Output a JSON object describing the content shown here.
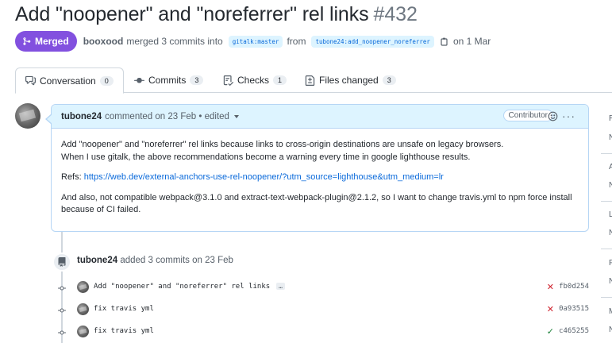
{
  "title": {
    "text": "Add \"noopener\" and \"noreferrer\" rel links",
    "number": "#432"
  },
  "meta": {
    "state": "Merged",
    "author": "booxood",
    "action_text": "merged 3 commits into",
    "base_branch": "gitalk:master",
    "from_text": "from",
    "head_branch": "tubone24:add_noopener_noreferrer",
    "date_text": "on 1 Mar"
  },
  "tabs": [
    {
      "label": "Conversation",
      "count": "0",
      "icon": "comment-discussion-icon"
    },
    {
      "label": "Commits",
      "count": "3",
      "icon": "git-commit-icon"
    },
    {
      "label": "Checks",
      "count": "1",
      "icon": "checklist-icon"
    },
    {
      "label": "Files changed",
      "count": "3",
      "icon": "file-diff-icon"
    }
  ],
  "comment": {
    "author": "tubone24",
    "header_text": "commented on 23 Feb • edited",
    "role": "Contributor",
    "body": {
      "line1": "Add \"noopener\" and \"noreferrer\" rel links because links to cross-origin destinations are unsafe on legacy browsers.",
      "line2": "When I use gitalk, the above recommendations become a warning every time in google lighthouse results.",
      "refs_label": "Refs:",
      "refs_link": "https://web.dev/external-anchors-use-rel-noopener/?utm_source=lighthouse&utm_medium=lr",
      "para3": "And also, not compatible webpack@3.1.0 and extract-text-webpack-plugin@2.1.2, so I want to change travis.yml to npm force install because of CI failed."
    }
  },
  "push_event": {
    "author": "tubone24",
    "text": "added 3 commits on 23 Feb"
  },
  "commits": [
    {
      "message": "Add \"noopener\" and \"noreferrer\" rel links",
      "has_more": true,
      "more_label": "…",
      "status": "failure",
      "status_glyph": "✕",
      "sha": "fb0d254"
    },
    {
      "message": "fix travis yml",
      "has_more": false,
      "status": "failure",
      "status_glyph": "✕",
      "sha": "0a93515"
    },
    {
      "message": "fix travis yml",
      "has_more": false,
      "status": "success",
      "status_glyph": "✓",
      "sha": "c465255"
    }
  ],
  "sidebar_fragments": [
    "R",
    "N",
    "A",
    "N",
    "L",
    "N",
    "P",
    "N",
    "M",
    "N"
  ],
  "colors": {
    "merged": "#8250df",
    "link": "#0969da",
    "failure": "#cf222e",
    "success": "#1a7f37",
    "header_bg": "#ddf4ff"
  }
}
